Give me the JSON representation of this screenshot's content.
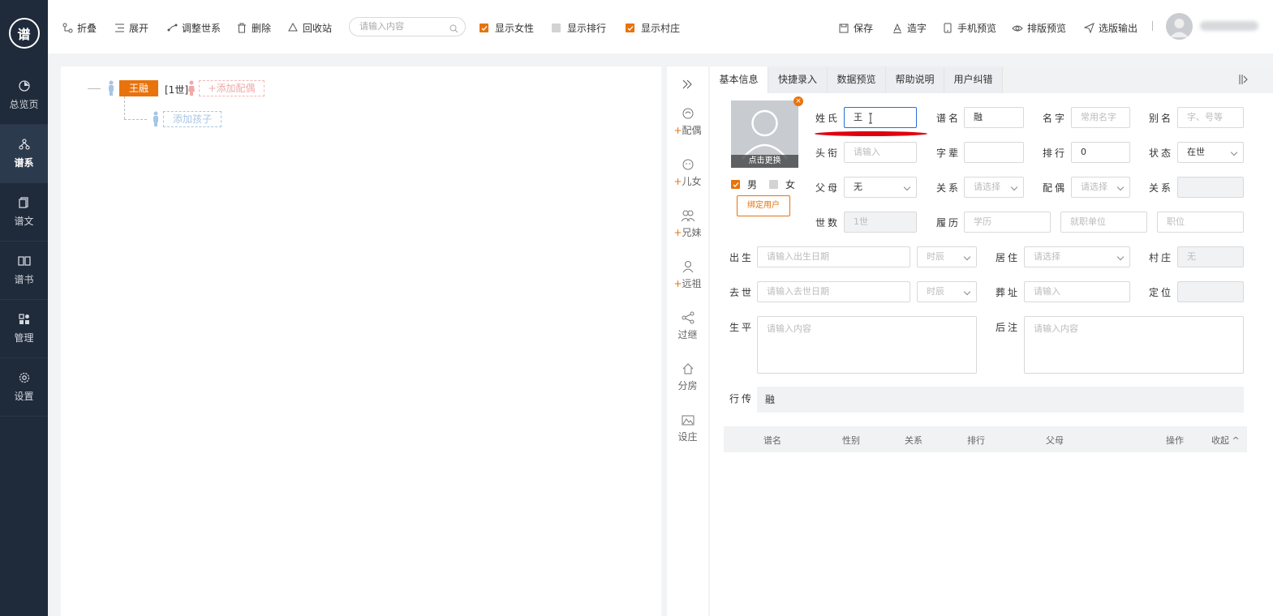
{
  "sidebar": {
    "logo_text": "谱",
    "items": [
      {
        "label": "总览页",
        "icon": "pie-chart-icon"
      },
      {
        "label": "谱系",
        "icon": "tree-icon",
        "active": true
      },
      {
        "label": "谱文",
        "icon": "document-icon"
      },
      {
        "label": "谱书",
        "icon": "book-icon"
      },
      {
        "label": "管理",
        "icon": "grid-icon"
      },
      {
        "label": "设置",
        "icon": "gear-icon"
      }
    ]
  },
  "toolbar": {
    "fold": "折叠",
    "expand": "展开",
    "adjust_generation": "调整世系",
    "delete": "删除",
    "recycle_bin": "回收站",
    "search_placeholder": "请输入内容",
    "show_female": "显示女性",
    "show_rank": "显示排行",
    "show_village": "显示村庄",
    "save": "保存",
    "create_char": "造字",
    "mobile_preview": "手机预览",
    "layout_preview": "排版预览",
    "output": "选版输出"
  },
  "tree": {
    "root_name": "王融",
    "root_generation": "[1世]",
    "add_spouse": "+添加配偶",
    "add_child": "添加孩子"
  },
  "vertical_actions": [
    {
      "label": "配偶",
      "plus": "+",
      "icon": "spouse-icon"
    },
    {
      "label": "儿女",
      "plus": "+",
      "icon": "child-icon"
    },
    {
      "label": "兄妹",
      "plus": "+",
      "icon": "siblings-icon"
    },
    {
      "label": "远祖",
      "plus": "+",
      "icon": "ancestor-icon"
    },
    {
      "label": "过继",
      "plus": "",
      "icon": "share-icon"
    },
    {
      "label": "分房",
      "plus": "",
      "icon": "house-icon"
    },
    {
      "label": "设庄",
      "plus": "",
      "icon": "landscape-icon"
    }
  ],
  "panel": {
    "tabs": [
      "基本信息",
      "快捷录入",
      "数据预览",
      "帮助说明",
      "用户纠错"
    ],
    "photo_change": "点击更换",
    "gender_male": "男",
    "gender_female": "女",
    "bind_user": "绑定用户",
    "fields": {
      "surname_label": "姓氏",
      "surname_value": "王",
      "puming_label": "谱名",
      "puming_value": "融",
      "mingzi_label": "名字",
      "mingzi_placeholder": "常用名字",
      "bieming_label": "别名",
      "bieming_placeholder": "字、号等",
      "touxian_label": "头衔",
      "touxian_placeholder": "请输入",
      "zibei_label": "字辈",
      "zibei_value": "",
      "paihang_label": "排行",
      "paihang_value": "0",
      "zhuangtai_label": "状态",
      "zhuangtai_value": "在世",
      "fumu_label": "父母",
      "fumu_value": "无",
      "guanxi_label": "关系",
      "guanxi_placeholder": "请选择",
      "peiou_label": "配偶",
      "peiou_placeholder": "请选择",
      "guanxi2_label": "关系",
      "shishu_label": "世数",
      "shishu_value": "1世",
      "lvli_label": "履历",
      "xueli_placeholder": "学历",
      "danwei_placeholder": "就职单位",
      "zhiwei_placeholder": "职位",
      "chusheng_label": "出生",
      "chusheng_placeholder": "请输入出生日期",
      "shichen_placeholder": "时辰",
      "juzhu_label": "居住",
      "juzhu_placeholder": "请选择",
      "cunzhuang_label": "村庄",
      "cunzhuang_value": "无",
      "qushi_label": "去世",
      "qushi_placeholder": "请输入去世日期",
      "shichen2_placeholder": "时辰",
      "zangzhi_label": "葬址",
      "zangzhi_placeholder": "请输入",
      "dingwei_label": "定位",
      "shengping_label": "生平",
      "shengping_placeholder": "请输入内容",
      "houzhu_label": "后注",
      "houzhu_placeholder": "请输入内容",
      "xingzhuan_label": "行传",
      "xingzhuan_value": "融"
    },
    "table_headers": [
      "谱名",
      "性别",
      "关系",
      "排行",
      "父母",
      "操作",
      "收起 ^"
    ]
  }
}
